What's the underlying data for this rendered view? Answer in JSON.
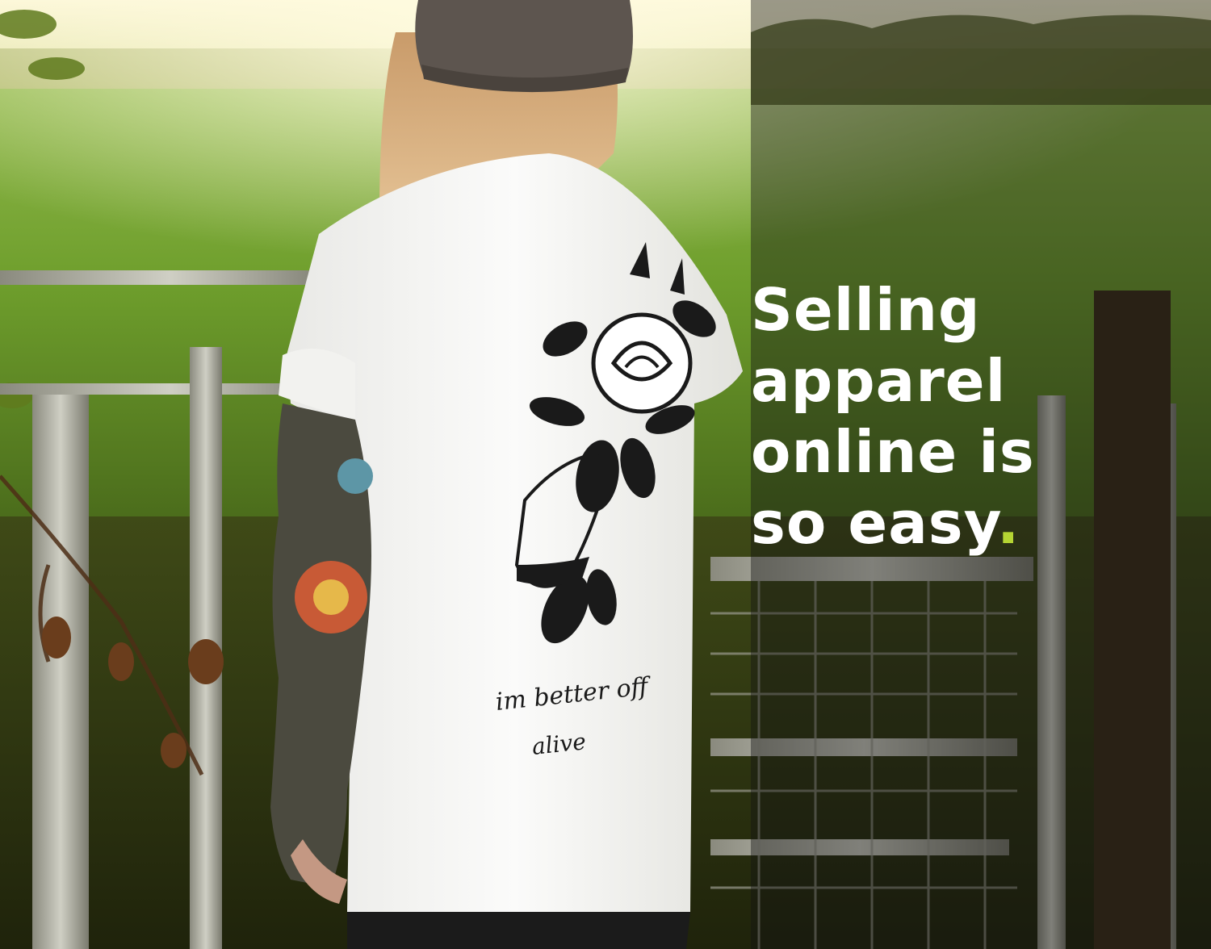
{
  "headline": {
    "lines": [
      "Selling",
      "apparel",
      "online is",
      "so easy"
    ],
    "end_mark": "."
  },
  "shirt_print": {
    "caption_line1": "im better off",
    "caption_line2": "alive"
  },
  "colors": {
    "accent": "#b5d433",
    "headline_text": "#ffffff",
    "panel_overlay": "rgba(20,20,20,0.42)"
  }
}
